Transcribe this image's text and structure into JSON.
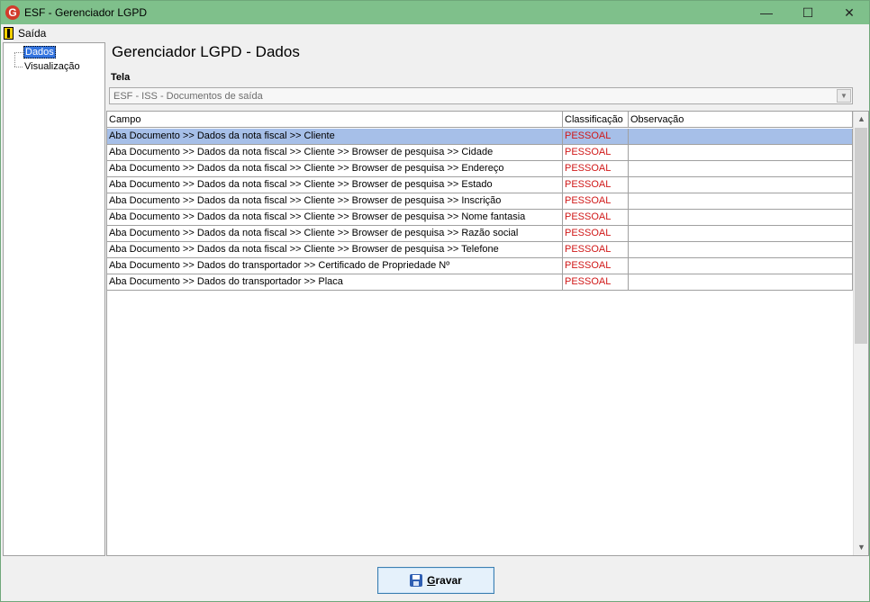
{
  "window": {
    "title": "ESF - Gerenciador LGPD",
    "app_icon_letter": "G",
    "controls": {
      "minimize": "—",
      "maximize": "☐",
      "close": "✕"
    }
  },
  "menu": {
    "items": [
      {
        "label": "Saída",
        "icon": "exit-door-icon"
      }
    ]
  },
  "tree": {
    "items": [
      {
        "label": "Dados",
        "selected": true
      },
      {
        "label": "Visualização",
        "selected": false
      }
    ]
  },
  "page": {
    "title": "Gerenciador LGPD - Dados"
  },
  "tela": {
    "label": "Tela",
    "value": "ESF - ISS - Documentos de saída"
  },
  "grid": {
    "columns": [
      "Campo",
      "Classificação",
      "Observação"
    ],
    "rows": [
      {
        "campo": "Aba Documento >> Dados da nota fiscal >> Cliente",
        "classificacao": "PESSOAL",
        "observacao": "",
        "selected": true
      },
      {
        "campo": "Aba Documento >> Dados da nota fiscal >> Cliente >> Browser de pesquisa >> Cidade",
        "classificacao": "PESSOAL",
        "observacao": ""
      },
      {
        "campo": "Aba Documento >> Dados da nota fiscal >> Cliente >> Browser de pesquisa >> Endereço",
        "classificacao": "PESSOAL",
        "observacao": ""
      },
      {
        "campo": "Aba Documento >> Dados da nota fiscal >> Cliente >> Browser de pesquisa >> Estado",
        "classificacao": "PESSOAL",
        "observacao": ""
      },
      {
        "campo": "Aba Documento >> Dados da nota fiscal >> Cliente >> Browser de pesquisa >> Inscrição",
        "classificacao": "PESSOAL",
        "observacao": ""
      },
      {
        "campo": "Aba Documento >> Dados da nota fiscal >> Cliente >> Browser de pesquisa >> Nome fantasia",
        "classificacao": "PESSOAL",
        "observacao": ""
      },
      {
        "campo": "Aba Documento >> Dados da nota fiscal >> Cliente >> Browser de pesquisa >> Razão social",
        "classificacao": "PESSOAL",
        "observacao": ""
      },
      {
        "campo": "Aba Documento >> Dados da nota fiscal >> Cliente >> Browser de pesquisa >> Telefone",
        "classificacao": "PESSOAL",
        "observacao": ""
      },
      {
        "campo": "Aba Documento >> Dados do transportador >> Certificado de Propriedade Nº",
        "classificacao": "PESSOAL",
        "observacao": ""
      },
      {
        "campo": "Aba Documento >> Dados do transportador >> Placa",
        "classificacao": "PESSOAL",
        "observacao": ""
      }
    ]
  },
  "footer": {
    "save_label_first": "G",
    "save_label_rest": "ravar",
    "save_icon": "floppy-disk-icon"
  },
  "colors": {
    "titlebar": "#7fc08b",
    "classification_text": "#d01818",
    "selected_row": "#a6bfe8",
    "tree_selection": "#3374e0"
  }
}
